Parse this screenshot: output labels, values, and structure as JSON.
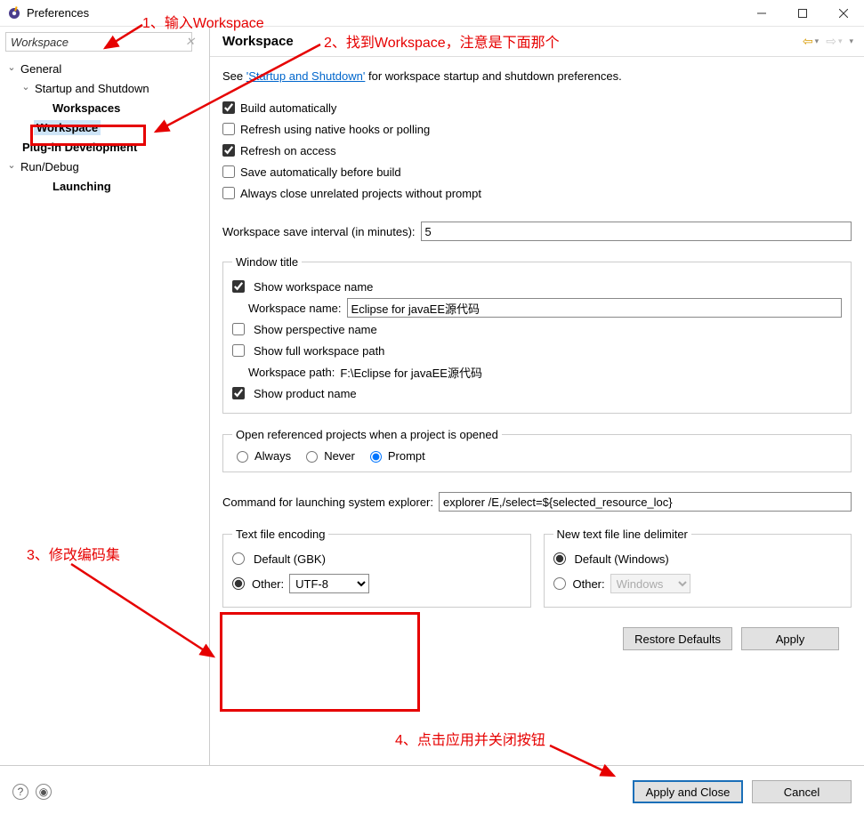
{
  "window": {
    "title": "Preferences"
  },
  "annotations": {
    "a1": "1、输入Workspace",
    "a2": "2、找到Workspace，注意是下面那个",
    "a3": "3、修改编码集",
    "a4": "4、点击应用并关闭按钮"
  },
  "sidebar": {
    "filter_value": "Workspace",
    "items": {
      "general": "General",
      "startup": "Startup and Shutdown",
      "workspaces": "Workspaces",
      "workspace": "Workspace",
      "plugin": "Plug-in Development",
      "rundebug": "Run/Debug",
      "launching": "Launching"
    }
  },
  "page": {
    "title": "Workspace",
    "intro_prefix": "See ",
    "intro_link": "'Startup and Shutdown'",
    "intro_suffix": " for workspace startup and shutdown preferences.",
    "checks": {
      "build_auto": "Build automatically",
      "refresh_hooks": "Refresh using native hooks or polling",
      "refresh_access": "Refresh on access",
      "save_before_build": "Save automatically before build",
      "close_unrelated": "Always close unrelated projects without prompt"
    },
    "save_interval_label": "Workspace save interval (in minutes):",
    "save_interval_value": "5",
    "window_title_group": {
      "legend": "Window title",
      "show_ws_name": "Show workspace name",
      "ws_name_label": "Workspace name:",
      "ws_name_value": "Eclipse for javaEE源代码",
      "show_perspective": "Show perspective name",
      "show_full_path": "Show full workspace path",
      "ws_path_label": "Workspace path:",
      "ws_path_value": "F:\\Eclipse for javaEE源代码",
      "show_product": "Show product name"
    },
    "open_ref_group": {
      "legend": "Open referenced projects when a project is opened",
      "always": "Always",
      "never": "Never",
      "prompt": "Prompt"
    },
    "explorer_label": "Command for launching system explorer:",
    "explorer_value": "explorer /E,/select=${selected_resource_loc}",
    "encoding_group": {
      "legend": "Text file encoding",
      "default_label": "Default (GBK)",
      "other_label": "Other:",
      "other_value": "UTF-8"
    },
    "line_delim_group": {
      "legend": "New text file line delimiter",
      "default_label": "Default (Windows)",
      "other_label": "Other:",
      "other_value": "Windows"
    },
    "buttons": {
      "restore": "Restore Defaults",
      "apply": "Apply",
      "apply_close": "Apply and Close",
      "cancel": "Cancel"
    }
  }
}
